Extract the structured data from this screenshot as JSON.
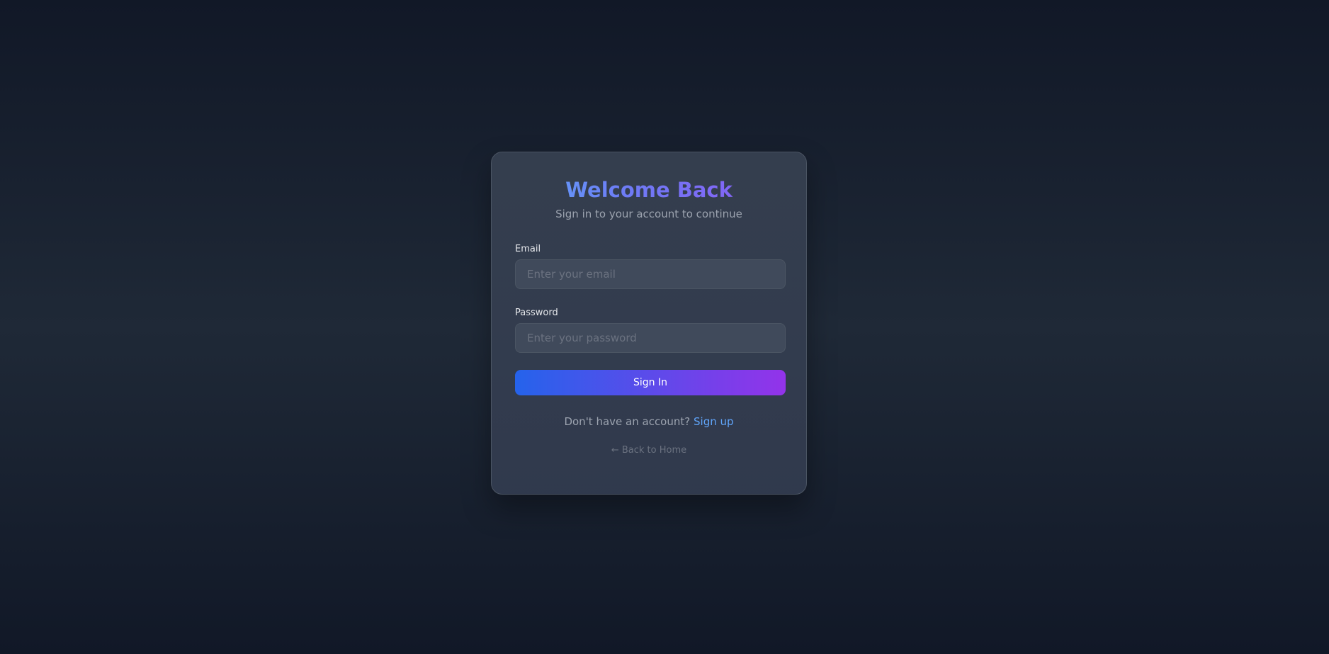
{
  "login": {
    "title": "Welcome Back",
    "subtitle": "Sign in to your account to continue",
    "email_label": "Email",
    "email_placeholder": "Enter your email",
    "email_value": "",
    "password_label": "Password",
    "password_placeholder": "Enter your password",
    "password_value": "",
    "submit_label": "Sign In",
    "signup_prompt": "Don't have an account?",
    "signup_link": "Sign up",
    "back_link": "← Back to Home"
  },
  "colors": {
    "accent_start": "#2563eb",
    "accent_end": "#9333ea",
    "link": "#60a5fa",
    "background": "#111827"
  }
}
